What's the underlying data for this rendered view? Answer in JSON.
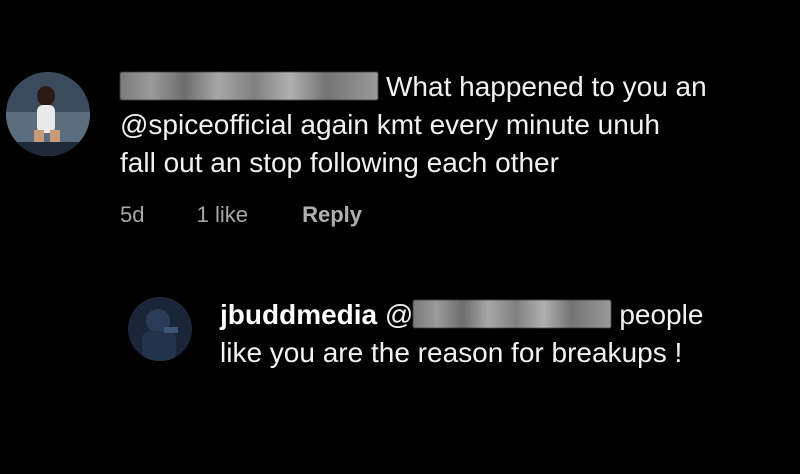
{
  "main_comment": {
    "avatar": "user-avatar-photo",
    "line1_text": "What happened to you an",
    "line2_text": "@spiceofficial again kmt every minute unuh",
    "line3_text": "fall out an stop following each other",
    "time": "5d",
    "likes": "1 like",
    "reply_label": "Reply"
  },
  "reply_comment": {
    "avatar": "user-avatar-photo",
    "username": "jbuddmedia",
    "mention_prefix": "@",
    "line1_suffix": "people",
    "line2_text": "like you are the reason for breakups !"
  },
  "colors": {
    "background": "#000000",
    "text": "#f2f2f2",
    "meta": "#a8a8a8"
  }
}
